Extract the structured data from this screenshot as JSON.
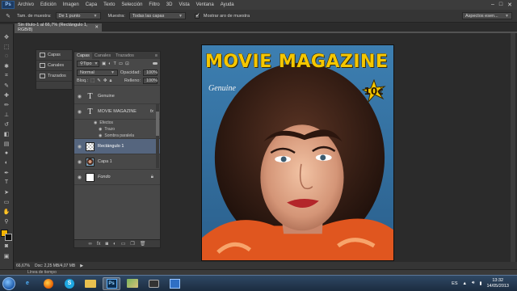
{
  "menubar": {
    "logo": "Ps",
    "items": [
      "Archivo",
      "Edición",
      "Imagen",
      "Capa",
      "Texto",
      "Selección",
      "Filtro",
      "3D",
      "Vista",
      "Ventana",
      "Ayuda"
    ],
    "window_controls": [
      "–",
      "□",
      "✕"
    ]
  },
  "options": {
    "sample_size_label": "Tam. de muestra:",
    "sample_size_value": "De 1 punto",
    "sample_label": "Muestra:",
    "sample_value": "Todas las capas",
    "show_ring_label": "Mostrar aro de muestra",
    "workspace_value": "Aspectos esen..."
  },
  "document": {
    "tab_title": "Sin título-1 al 66,7% (Rectángulo 1, RGB/8)",
    "zoom": "66,67%",
    "doc_info": "Doc: 2,25 MB/4,07 MB",
    "timeline_label": "Línea de tiempo"
  },
  "dock": {
    "items": [
      "Capas",
      "Canales",
      "Trazados"
    ]
  },
  "layers_panel": {
    "tabs": [
      "Capas",
      "Canales",
      "Trazados"
    ],
    "filter_value": "Tipo",
    "blend_mode": "Normal",
    "opacity_label": "Opacidad:",
    "opacity_value": "100%",
    "lock_label": "Bloq.:",
    "fill_label": "Relleno:",
    "fill_value": "100%",
    "layers": [
      {
        "name": "Genuine",
        "kind": "text"
      },
      {
        "name": "MOVIE MAGAZINE",
        "kind": "text",
        "fx": "fx"
      },
      {
        "name": "Rectángulo 1",
        "kind": "shape",
        "selected": true
      },
      {
        "name": "Capa 1",
        "kind": "photo"
      },
      {
        "name": "Fondo",
        "kind": "background"
      }
    ],
    "effects_label": "Efectos",
    "effect_items": [
      "Trazo",
      "Sombra paralela"
    ],
    "bottom_icons": [
      "link-icon",
      "fx-icon",
      "mask-icon",
      "adjustment-icon",
      "folder-icon",
      "new-layer-icon",
      "trash-icon"
    ]
  },
  "cover": {
    "title": "MOVIE MAGAZINE",
    "subtitle": "Genuine",
    "price": "10¢",
    "title_color": "#f5c700"
  },
  "taskbar": {
    "language": "ES",
    "time": "13:32",
    "date": "14/05/2013"
  }
}
